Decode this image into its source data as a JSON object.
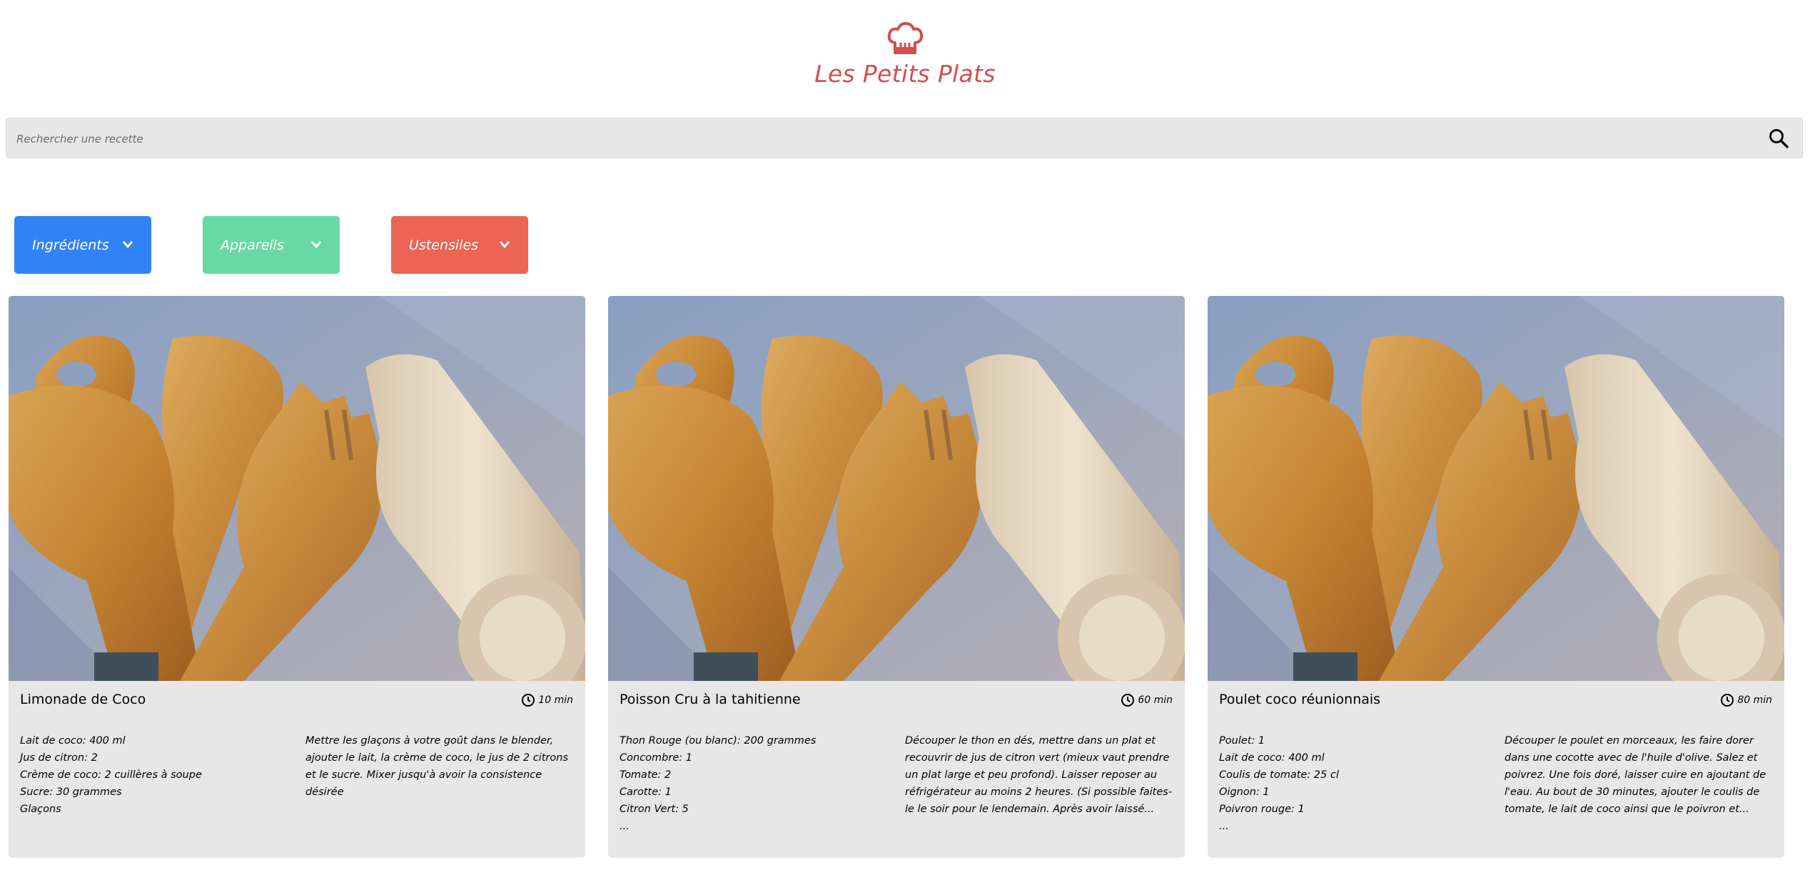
{
  "header": {
    "title": "Les Petits Plats",
    "logo_icon": "chef-hat-icon",
    "brand_color": "#d04f4f"
  },
  "search": {
    "placeholder": "Rechercher une recette",
    "icon": "search-icon"
  },
  "filters": [
    {
      "label": "Ingrédients",
      "color": "#3282f7",
      "icon": "chevron-down-icon"
    },
    {
      "label": "Appareils",
      "color": "#68d9a4",
      "icon": "chevron-down-icon"
    },
    {
      "label": "Ustensiles",
      "color": "#ed6454",
      "icon": "chevron-down-icon"
    }
  ],
  "recipes": [
    {
      "title": "Limonade de Coco",
      "time": "10 min",
      "ingredients": [
        "Lait de coco: 400 ml",
        "Jus de citron: 2",
        "Crème de coco: 2 cuillères à soupe",
        "Sucre: 30 grammes",
        "Glaçons"
      ],
      "description": "Mettre les glaçons à votre goût dans le blender, ajouter le lait, la crème de coco, le jus de 2 citrons et le sucre. Mixer jusqu'à avoir la consistence désirée"
    },
    {
      "title": "Poisson Cru à la tahitienne",
      "time": "60 min",
      "ingredients": [
        "Thon Rouge (ou blanc): 200 grammes",
        "Concombre: 1",
        "Tomate: 2",
        "Carotte: 1",
        "Citron Vert: 5",
        "..."
      ],
      "description": "Découper le thon en dés, mettre dans un plat et recouvrir de jus de citron vert (mieux vaut prendre un plat large et peu profond). Laisser reposer au réfrigérateur au moins 2 heures. (Si possible faites-le le soir pour le lendemain. Après avoir laissé..."
    },
    {
      "title": "Poulet coco réunionnais",
      "time": "80 min",
      "ingredients": [
        "Poulet: 1",
        "Lait de coco: 400 ml",
        "Coulis de tomate: 25 cl",
        "Oignon: 1",
        "Poivron rouge: 1",
        "..."
      ],
      "description": "Découper le poulet en morceaux, les faire dorer dans une cocotte avec de l'huile d'olive. Salez et poivrez. Une fois doré, laisser cuire en ajoutant de l'eau. Au bout de 30 minutes, ajouter le coulis de tomate, le lait de coco ainsi que le poivron et..."
    }
  ]
}
